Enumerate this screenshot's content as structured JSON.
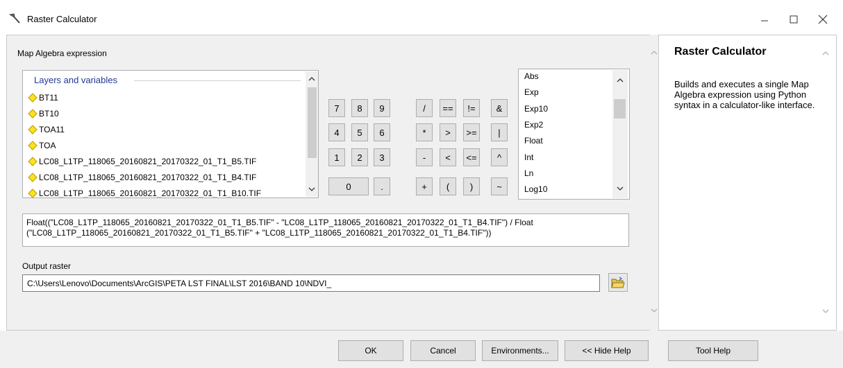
{
  "window": {
    "title": "Raster Calculator",
    "icon": "hammer-icon"
  },
  "labels": {
    "expression": "Map Algebra expression",
    "layers_header": "Layers and variables",
    "output": "Output raster"
  },
  "layers": [
    "BT11",
    "BT10",
    "TOA11",
    "TOA",
    "LC08_L1TP_118065_20160821_20170322_01_T1_B5.TIF",
    "LC08_L1TP_118065_20160821_20170322_01_T1_B4.TIF",
    "LC08_L1TP_118065_20160821_20170322_01_T1_B10.TIF"
  ],
  "calculator": {
    "row1": [
      "7",
      "8",
      "9",
      "/",
      "==",
      "!=",
      "&"
    ],
    "row2": [
      "4",
      "5",
      "6",
      "*",
      ">",
      ">=",
      "|"
    ],
    "row3": [
      "1",
      "2",
      "3",
      "-",
      "<",
      "<=",
      "^"
    ],
    "row4": [
      "0",
      ".",
      "+",
      "(",
      ")",
      "~"
    ]
  },
  "functions": [
    "Abs",
    "Exp",
    "Exp10",
    "Exp2",
    "Float",
    "Int",
    "Ln",
    "Log10"
  ],
  "expression": "Float((\"LC08_L1TP_118065_20160821_20170322_01_T1_B5.TIF\" - \"LC08_L1TP_118065_20160821_20170322_01_T1_B4.TIF\") / Float\n(\"LC08_L1TP_118065_20160821_20170322_01_T1_B5.TIF\" + \"LC08_L1TP_118065_20160821_20170322_01_T1_B4.TIF\"))",
  "output_path": "C:\\Users\\Lenovo\\Documents\\ArcGIS\\PETA LST FINAL\\LST 2016\\BAND 10\\NDVI_",
  "help": {
    "title": "Raster Calculator",
    "description": "Builds and executes a single Map Algebra expression using Python syntax in a calculator-like interface."
  },
  "buttons": {
    "ok": "OK",
    "cancel": "Cancel",
    "environments": "Environments...",
    "hide_help": "<< Hide Help",
    "tool_help": "Tool Help"
  }
}
